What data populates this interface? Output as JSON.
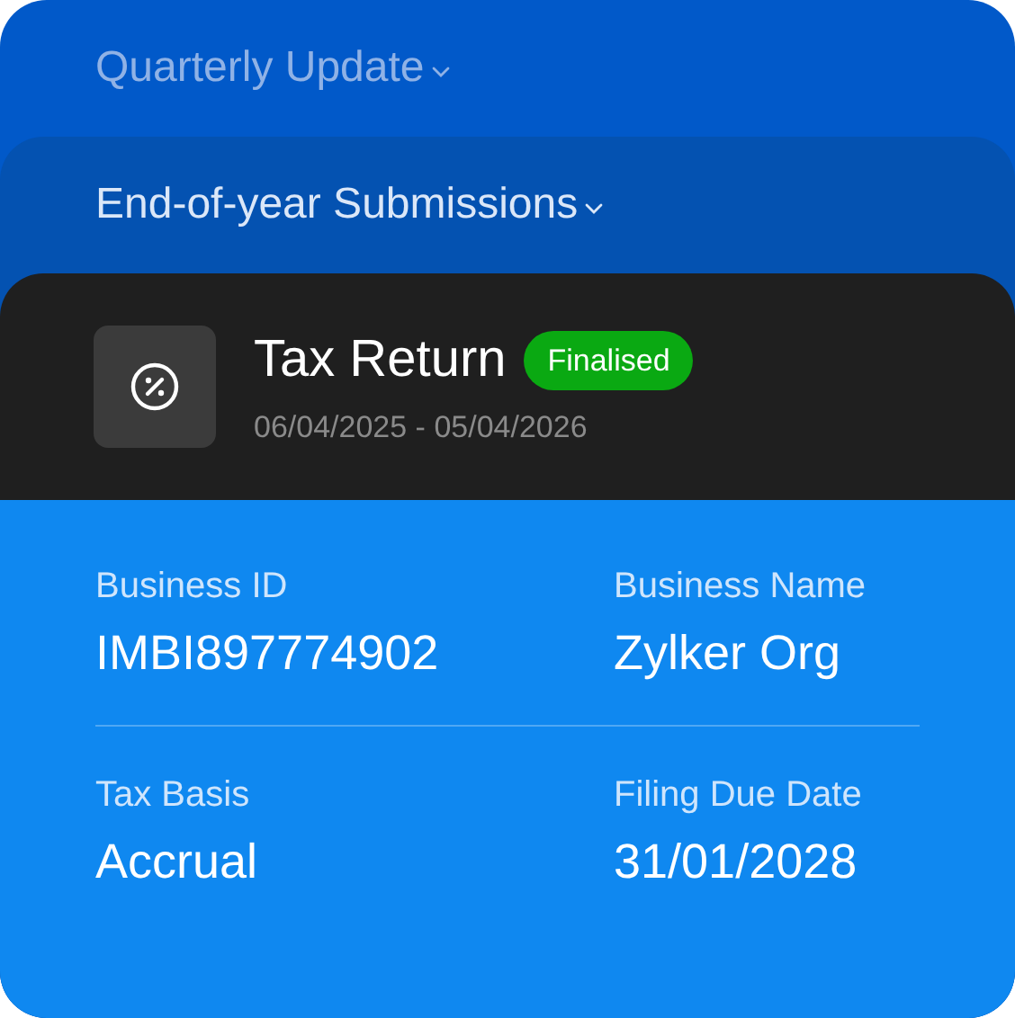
{
  "sections": [
    {
      "title": "Quarterly Update"
    },
    {
      "title": "End-of-year Submissions"
    }
  ],
  "return": {
    "title": "Tax Return",
    "status": "Finalised",
    "period": "06/04/2025 - 05/04/2026"
  },
  "details": [
    [
      {
        "label": "Business ID",
        "value": "IMBI897774902"
      },
      {
        "label": "Business Name",
        "value": "Zylker Org"
      }
    ],
    [
      {
        "label": "Tax Basis",
        "value": "Accrual"
      },
      {
        "label": "Filing Due Date",
        "value": "31/01/2028"
      }
    ]
  ]
}
